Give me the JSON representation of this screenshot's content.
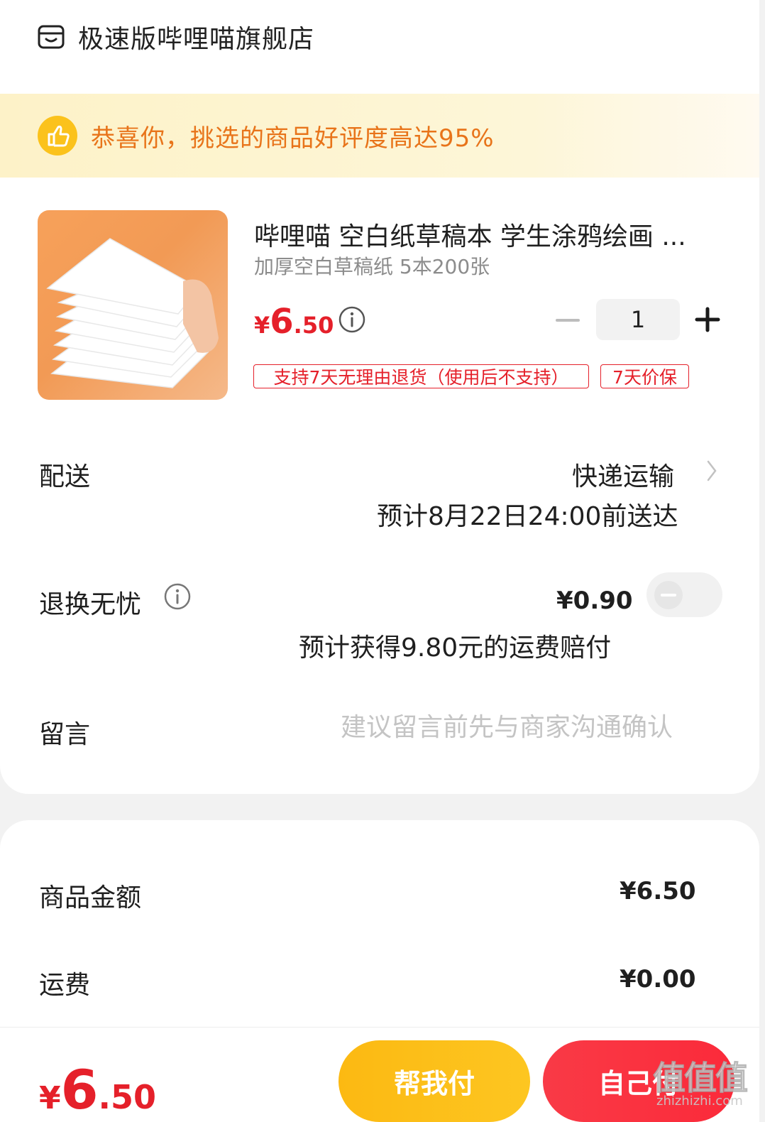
{
  "store": {
    "name": "极速版哔哩喵旗舰店",
    "icon": "store-icon"
  },
  "praise": {
    "text": "恭喜你，挑选的商品好评度高达95%",
    "icon": "thumbs-up-icon"
  },
  "product": {
    "title": "哔哩喵 空白纸草稿本 学生涂鸦绘画 ...",
    "spec": "加厚空白草稿纸 5本200张",
    "price_symbol": "¥",
    "price_int": "6",
    "price_dec": ".50",
    "quantity": "1",
    "tags": [
      "支持7天无理由退货（使用后不支持）",
      "7天价保"
    ]
  },
  "delivery": {
    "label": "配送",
    "method": "快递运输",
    "eta": "预计8月22日24:00前送达"
  },
  "return_insurance": {
    "label": "退换无忧",
    "price": "¥0.90",
    "note": "预计获得9.80元的运费赔付",
    "enabled": false
  },
  "message": {
    "label": "留言",
    "placeholder": "建议留言前先与商家沟通确认"
  },
  "summary": {
    "goods_label": "商品金额",
    "goods_value": "¥6.50",
    "shipping_label": "运费",
    "shipping_value": "¥0.00"
  },
  "footer": {
    "total_symbol": "¥",
    "total_int": "6",
    "total_dec": ".50",
    "help_pay_label": "帮我付",
    "self_pay_label": "自己付"
  },
  "watermark": {
    "text": "值值值",
    "sub": "zhizhizhi.com"
  },
  "colors": {
    "accent_red": "#e5202a",
    "praise_orange": "#e8741a",
    "help_btn": "#fcb912",
    "self_btn": "#f93a46"
  }
}
